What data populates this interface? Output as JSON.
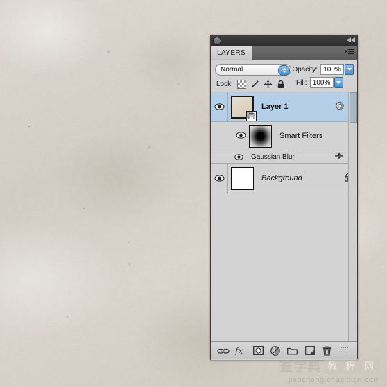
{
  "panel": {
    "tab_label": "LAYERS",
    "blend_mode": "Normal",
    "opacity_label": "Opacity:",
    "opacity_value": "100%",
    "fill_label": "Fill:",
    "fill_value": "100%",
    "lock_label": "Lock:",
    "lock_icons": [
      "transparency-lock-icon",
      "brush-lock-icon",
      "move-lock-icon",
      "lock-all-icon"
    ],
    "collapse_icon": "collapse-arrows-icon",
    "menu_icon": "panel-menu-icon",
    "rows": [
      {
        "name": "Layer 1",
        "style": "bold",
        "visible": true,
        "thumb": "smart-object-thumbnail",
        "badge": "smart-object-badge",
        "right_icons": [
          "smart-filter-effects-icon",
          "expand-arrow-icon"
        ]
      },
      {
        "name": "Smart Filters",
        "style": "normal",
        "visible": true,
        "thumb": "filter-mask-thumbnail",
        "badge": "",
        "right_icons": []
      },
      {
        "name": "Gaussian Blur",
        "style": "normal",
        "visible": true,
        "thumb": "",
        "badge": "",
        "right_icons": [
          "blending-options-icon"
        ]
      },
      {
        "name": "Background",
        "style": "italic",
        "visible": true,
        "thumb": "white-layer-thumbnail",
        "badge": "",
        "right_icons": [
          "lock-icon"
        ]
      }
    ],
    "bottom_tools": [
      "link-layers-icon",
      "layer-style-fx-icon",
      "add-layer-mask-icon",
      "new-fill-adjustment-icon",
      "new-group-icon",
      "new-layer-icon",
      "delete-layer-icon",
      "resize-grip-icon"
    ]
  },
  "watermark": {
    "text_left": "查字典",
    "text_right": "教 程 网",
    "url": "jiaocheng.chazidian.com"
  },
  "colors": {
    "panel_bg": "#d3d3d3",
    "selected_row": "#b6cfe8",
    "titlebar": "#2e2e2e",
    "accent_blue": "#4b8fd0",
    "canvas": "#ddd7ce"
  }
}
